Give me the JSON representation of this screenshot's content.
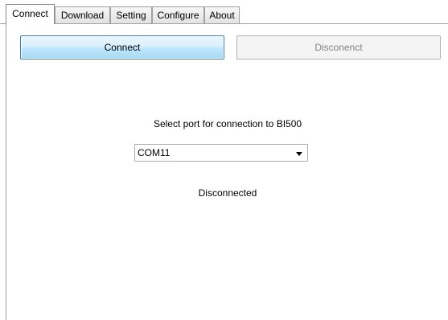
{
  "tabs": [
    {
      "label": "Connect",
      "active": true
    },
    {
      "label": "Download",
      "active": false
    },
    {
      "label": "Setting",
      "active": false
    },
    {
      "label": "Configure",
      "active": false
    },
    {
      "label": "About",
      "active": false
    }
  ],
  "buttons": {
    "connect_label": "Connect",
    "disconnect_label": "Disconenct"
  },
  "port": {
    "prompt": "Select port for connection to BI500",
    "selected": "COM11",
    "icon": "chevron-down-icon"
  },
  "status": {
    "text": "Disconnected"
  },
  "colors": {
    "connect_border": "#3c7fb1",
    "disabled_text": "#838383"
  }
}
